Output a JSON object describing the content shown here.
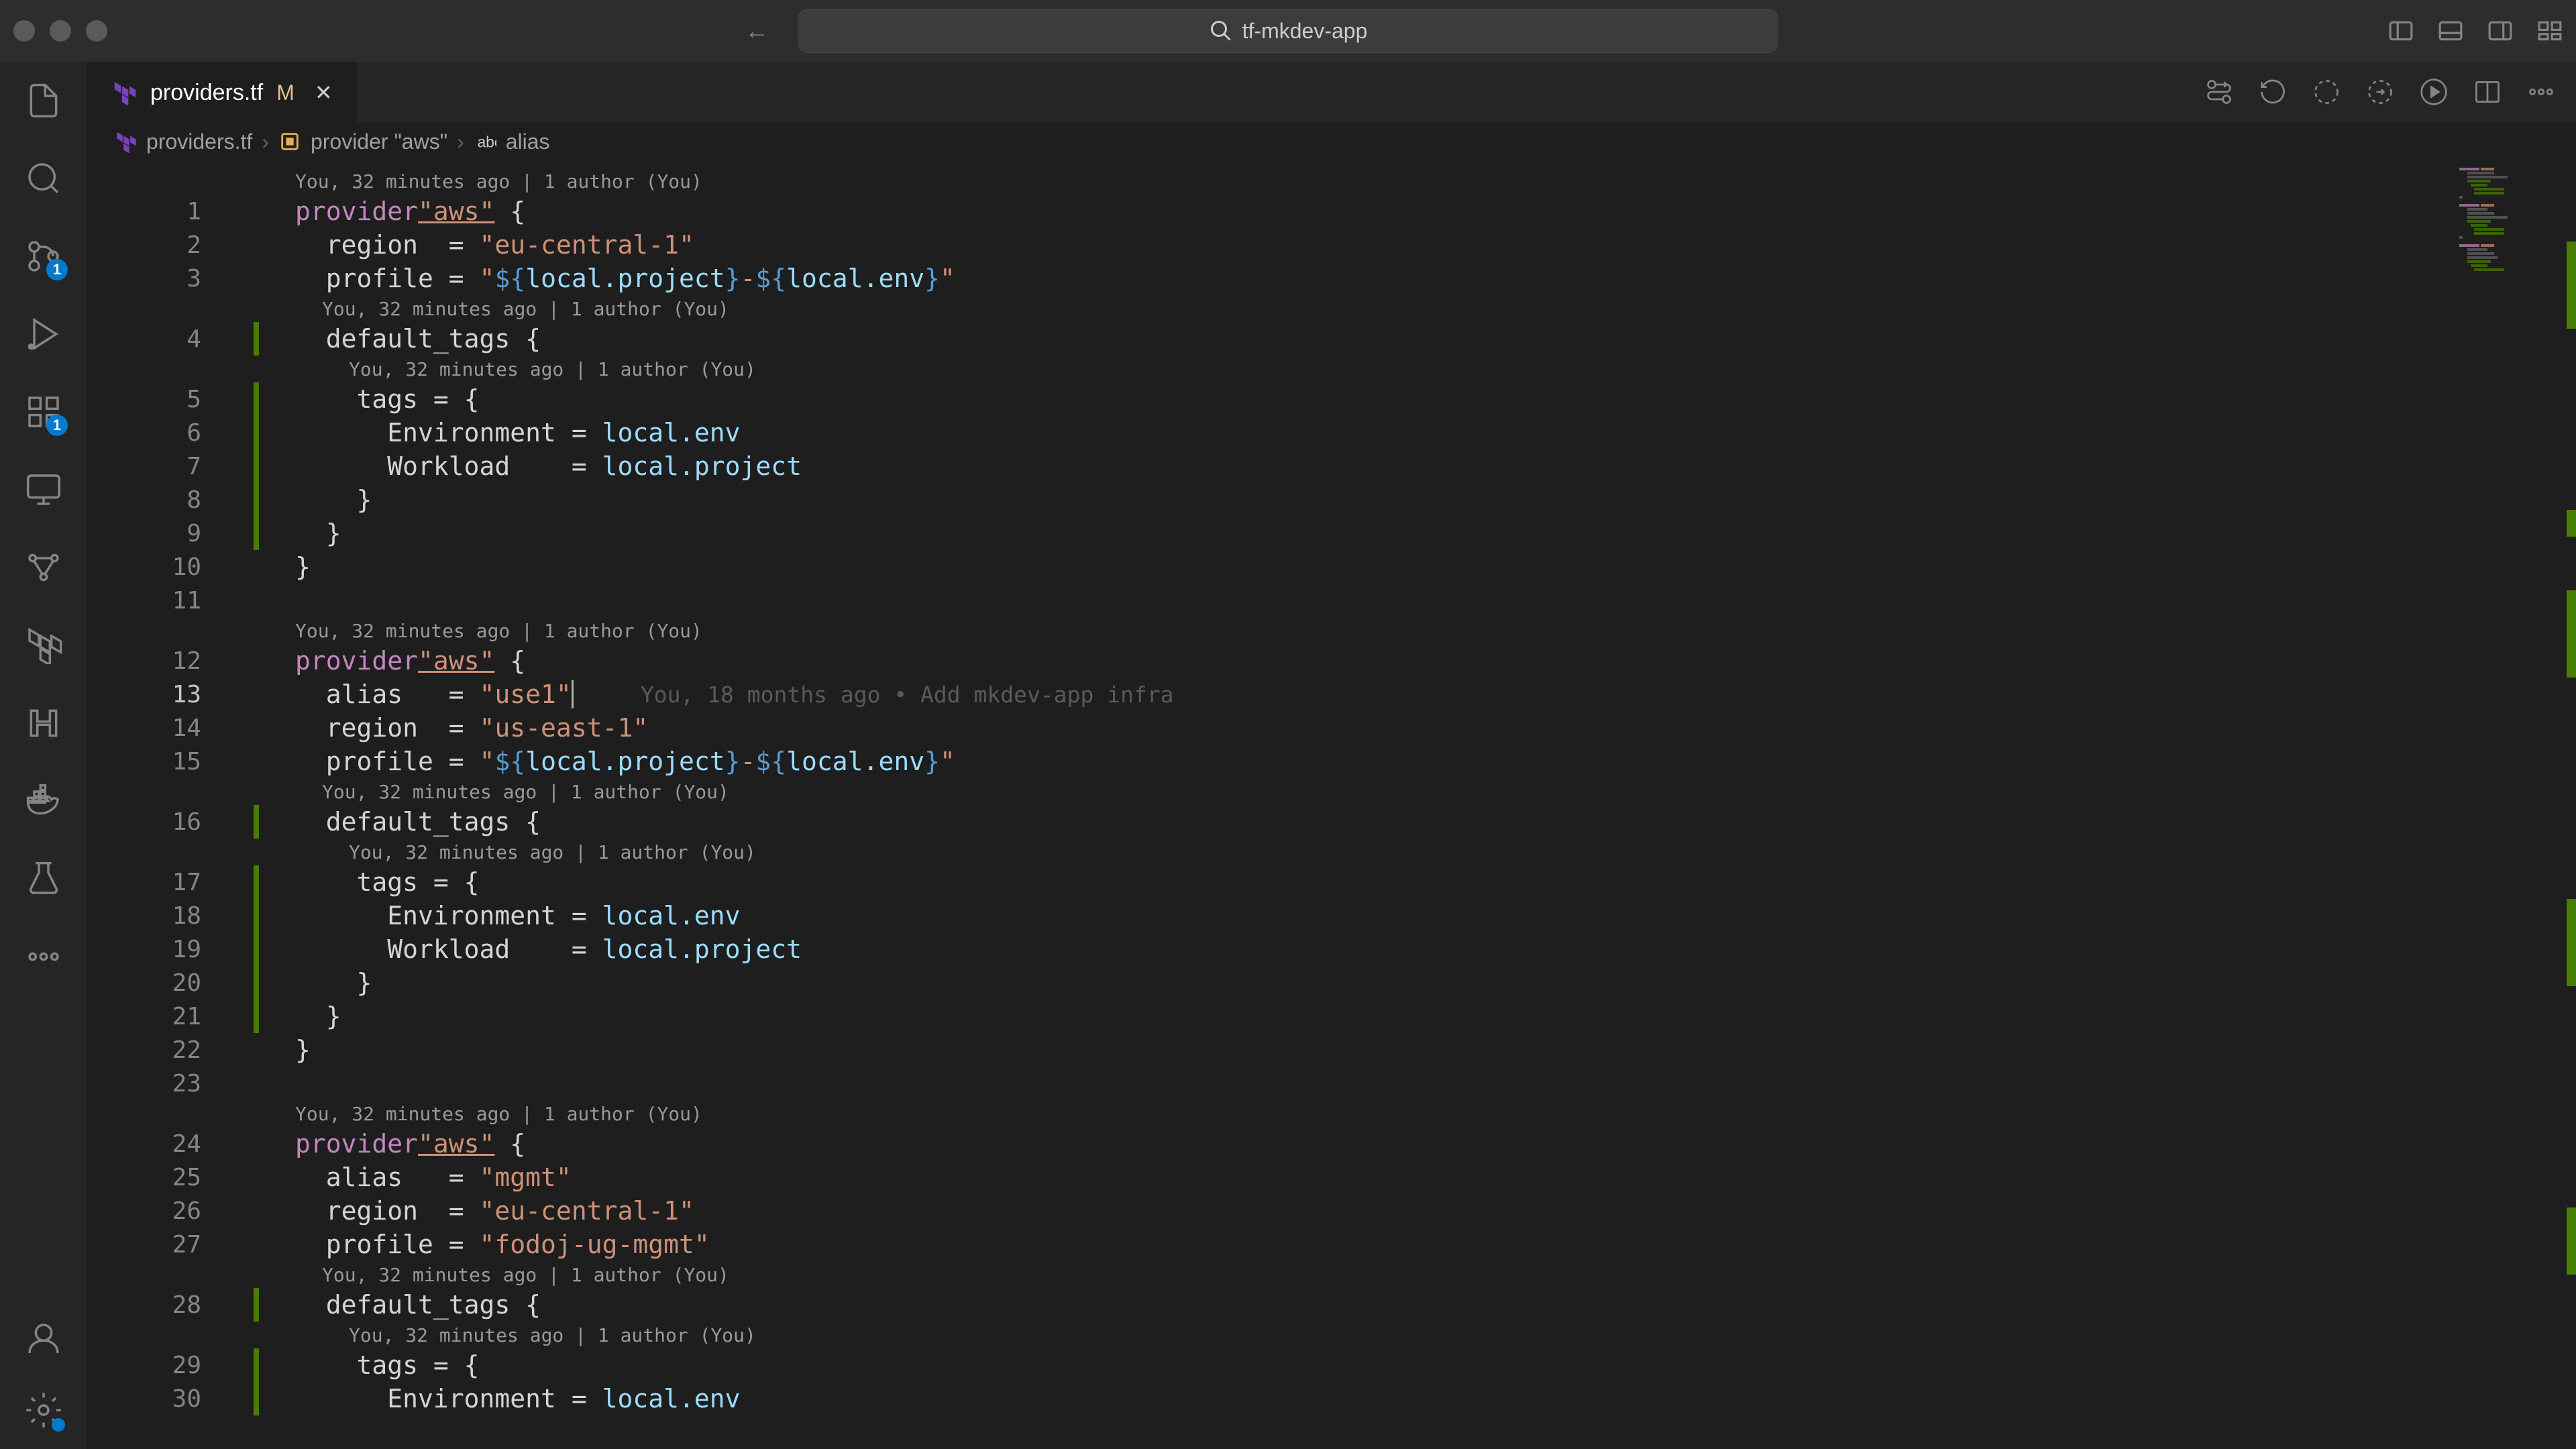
{
  "titlebar": {
    "search_text": "tf-mkdev-app"
  },
  "tab": {
    "filename": "providers.tf",
    "modified_indicator": "M"
  },
  "breadcrumbs": {
    "file": "providers.tf",
    "symbol1": "provider \"aws\"",
    "symbol2": "alias"
  },
  "codelens": {
    "author": "You, 32 minutes ago | 1 author (You)"
  },
  "blame": {
    "line13": "You, 18 months ago • Add mkdev-app infra"
  },
  "badges": {
    "scm": "1",
    "extensions": "1"
  },
  "code": {
    "l1": {
      "kw": "provider",
      "str": "\"aws\"",
      "brace": " {"
    },
    "l2": {
      "prop": "  region  ",
      "eq": "= ",
      "str": "\"eu-central-1\""
    },
    "l3": {
      "prop": "  profile ",
      "eq": "= ",
      "q1": "\"",
      "i1": "${",
      "v1": "local.project",
      "c1": "}",
      "dash": "-",
      "i2": "${",
      "v2": "local.env",
      "c2": "}",
      "q2": "\""
    },
    "l4": {
      "prop": "  default_tags",
      "brace": " {"
    },
    "l5": {
      "prop": "    tags ",
      "eq": "= ",
      "brace": "{"
    },
    "l6": {
      "prop": "      Environment ",
      "eq": "= ",
      "val": "local.env"
    },
    "l7": {
      "prop": "      Workload    ",
      "eq": "= ",
      "val": "local.project"
    },
    "l8": {
      "brace": "    }"
    },
    "l9": {
      "brace": "  }"
    },
    "l10": {
      "brace": "}"
    },
    "l12": {
      "kw": "provider",
      "str": "\"aws\"",
      "brace": " {"
    },
    "l13": {
      "prop": "  alias   ",
      "eq": "= ",
      "str": "\"use1\""
    },
    "l14": {
      "prop": "  region  ",
      "eq": "= ",
      "str": "\"us-east-1\""
    },
    "l15": {
      "prop": "  profile ",
      "eq": "= ",
      "q1": "\"",
      "i1": "${",
      "v1": "local.project",
      "c1": "}",
      "dash": "-",
      "i2": "${",
      "v2": "local.env",
      "c2": "}",
      "q2": "\""
    },
    "l16": {
      "prop": "  default_tags",
      "brace": " {"
    },
    "l17": {
      "prop": "    tags ",
      "eq": "= ",
      "brace": "{"
    },
    "l18": {
      "prop": "      Environment ",
      "eq": "= ",
      "val": "local.env"
    },
    "l19": {
      "prop": "      Workload    ",
      "eq": "= ",
      "val": "local.project"
    },
    "l20": {
      "brace": "    }"
    },
    "l21": {
      "brace": "  }"
    },
    "l22": {
      "brace": "}"
    },
    "l24": {
      "kw": "provider",
      "str": "\"aws\"",
      "brace": " {"
    },
    "l25": {
      "prop": "  alias   ",
      "eq": "= ",
      "str": "\"mgmt\""
    },
    "l26": {
      "prop": "  region  ",
      "eq": "= ",
      "str": "\"eu-central-1\""
    },
    "l27": {
      "prop": "  profile ",
      "eq": "= ",
      "str": "\"fodoj-ug-mgmt\""
    },
    "l28": {
      "prop": "  default_tags",
      "brace": " {"
    },
    "l29": {
      "prop": "    tags ",
      "eq": "= ",
      "brace": "{"
    },
    "l30": {
      "prop": "      Environment ",
      "eq": "= ",
      "val": "local.env"
    }
  },
  "line_numbers": [
    "1",
    "2",
    "3",
    "4",
    "5",
    "6",
    "7",
    "8",
    "9",
    "10",
    "11",
    "12",
    "13",
    "14",
    "15",
    "16",
    "17",
    "18",
    "19",
    "20",
    "21",
    "22",
    "23",
    "24",
    "25",
    "26",
    "27",
    "28",
    "29",
    "30"
  ]
}
